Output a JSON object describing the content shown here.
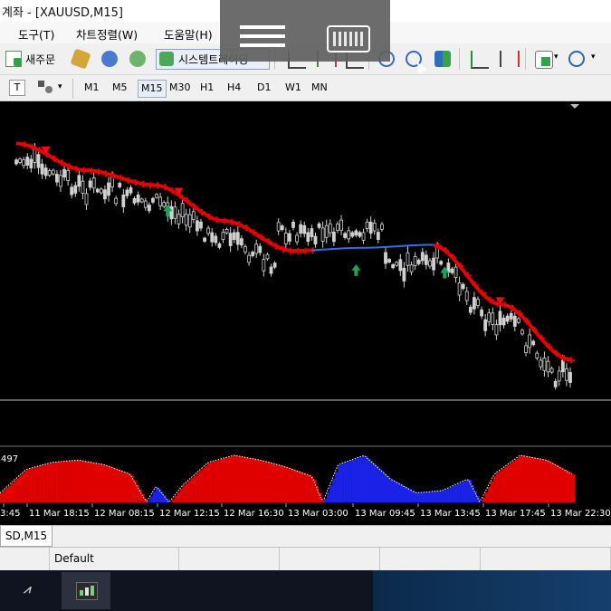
{
  "window": {
    "title": "계좌 - [XAUUSD,M15]"
  },
  "menu": [
    "도구(T)",
    "차트정렬(W)",
    "도움말(H)"
  ],
  "toolbar": {
    "new_order": "새주문",
    "auto_trading": "시스템트레이딩"
  },
  "timeframes": {
    "items": [
      "M1",
      "M5",
      "M15",
      "M30",
      "H1",
      "H4",
      "D1",
      "W1",
      "MN"
    ],
    "active": "M15"
  },
  "indicator": {
    "value_label": "497"
  },
  "time_axis": [
    "3:45",
    "11 Mar 18:15",
    "12 Mar 08:15",
    "12 Mar 12:15",
    "12 Mar 16:30",
    "13 Mar 03:00",
    "13 Mar 09:45",
    "13 Mar 13:45",
    "13 Mar 17:45",
    "13 Mar 22:30"
  ],
  "chart_tab": "SD,M15",
  "status": {
    "profile": "Default"
  },
  "colors": {
    "down_trend": "#e60000",
    "up_trend": "#3a6ee8",
    "candle": "#d0d0d0",
    "buy_arrow": "#1aa35a",
    "sell_arrow": "#e8101c"
  },
  "chart_data": {
    "type": "line",
    "symbol": "XAUUSD",
    "timeframe": "M15",
    "x": [
      "11 Mar 18:15",
      "12 Mar 08:15",
      "12 Mar 12:15",
      "12 Mar 16:30",
      "13 Mar 03:00",
      "13 Mar 09:45",
      "13 Mar 13:45",
      "13 Mar 17:45",
      "13 Mar 22:30"
    ],
    "series": [
      {
        "values": [
          0.9,
          0.72,
          0.62,
          0.38,
          0.18,
          0.2,
          0.22,
          -0.18,
          -0.55
        ]
      }
    ],
    "histogram": {
      "values": [
        0.2,
        0.7,
        0.85,
        0.9,
        0.8,
        0.6,
        -0.35,
        0.35,
        0.85,
        1.0,
        0.9,
        0.75,
        0.55,
        -0.8,
        -1.0,
        -0.5,
        -0.2,
        -0.25,
        -0.5,
        0.6,
        1.0,
        0.9,
        0.6
      ]
    },
    "grid": false
  }
}
